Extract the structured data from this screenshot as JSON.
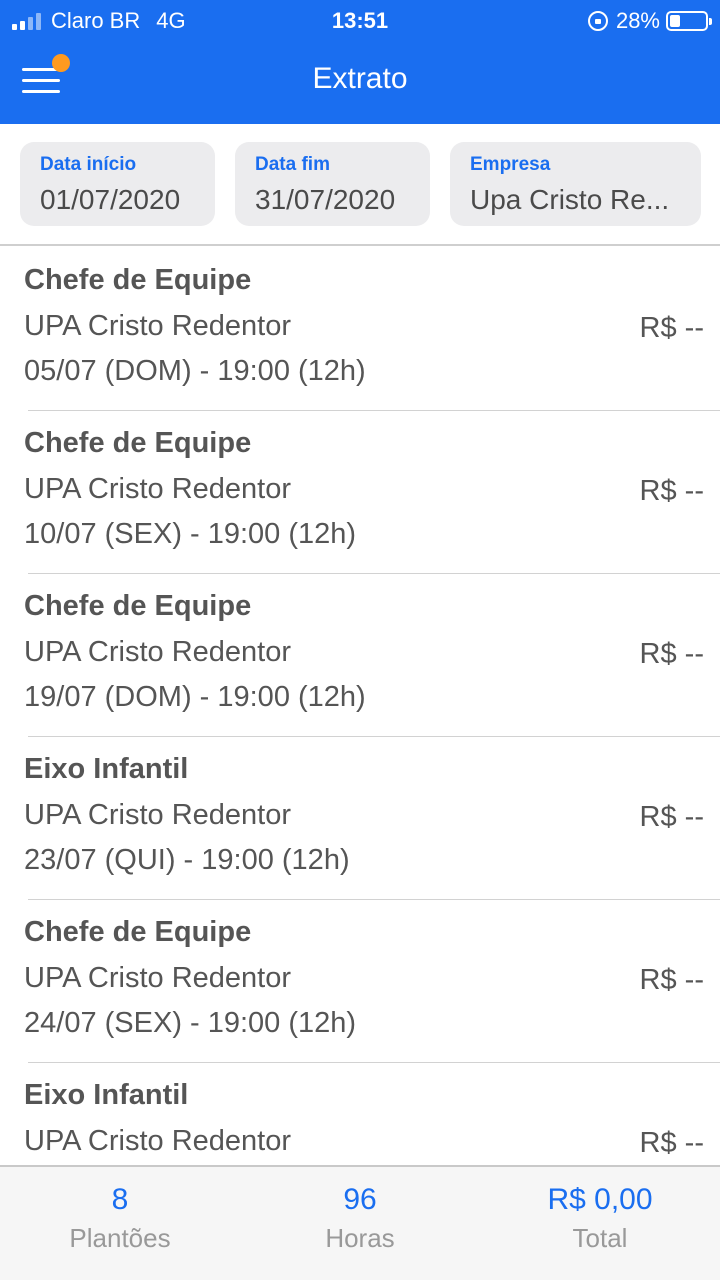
{
  "status_bar": {
    "carrier": "Claro BR",
    "network": "4G",
    "time": "13:51",
    "battery": "28%",
    "battery_level": 0.28
  },
  "header": {
    "title": "Extrato"
  },
  "filters": {
    "start": {
      "label": "Data início",
      "value": "01/07/2020"
    },
    "end": {
      "label": "Data fim",
      "value": "31/07/2020"
    },
    "company": {
      "label": "Empresa",
      "value": "Upa Cristo Re..."
    }
  },
  "items": [
    {
      "title": "Chefe de Equipe",
      "company": "UPA Cristo Redentor",
      "date": "05/07 (DOM) - 19:00 (12h)",
      "value": "R$ --"
    },
    {
      "title": "Chefe de Equipe",
      "company": "UPA Cristo Redentor",
      "date": "10/07 (SEX) - 19:00 (12h)",
      "value": "R$ --"
    },
    {
      "title": "Chefe de Equipe",
      "company": "UPA Cristo Redentor",
      "date": "19/07 (DOM) - 19:00 (12h)",
      "value": "R$ --"
    },
    {
      "title": "Eixo Infantil",
      "company": "UPA Cristo Redentor",
      "date": "23/07 (QUI) - 19:00 (12h)",
      "value": "R$ --"
    },
    {
      "title": "Chefe de Equipe",
      "company": "UPA Cristo Redentor",
      "date": "24/07 (SEX) - 19:00 (12h)",
      "value": "R$ --"
    },
    {
      "title": "Eixo Infantil",
      "company": "UPA Cristo Redentor",
      "date": "",
      "value": "R$ --"
    }
  ],
  "footer": {
    "shifts": {
      "value": "8",
      "label": "Plantões"
    },
    "hours": {
      "value": "96",
      "label": "Horas"
    },
    "total": {
      "value": "R$ 0,00",
      "label": "Total"
    }
  },
  "colors": {
    "primary": "#1a6ef0",
    "notification": "#ff9a1f"
  }
}
